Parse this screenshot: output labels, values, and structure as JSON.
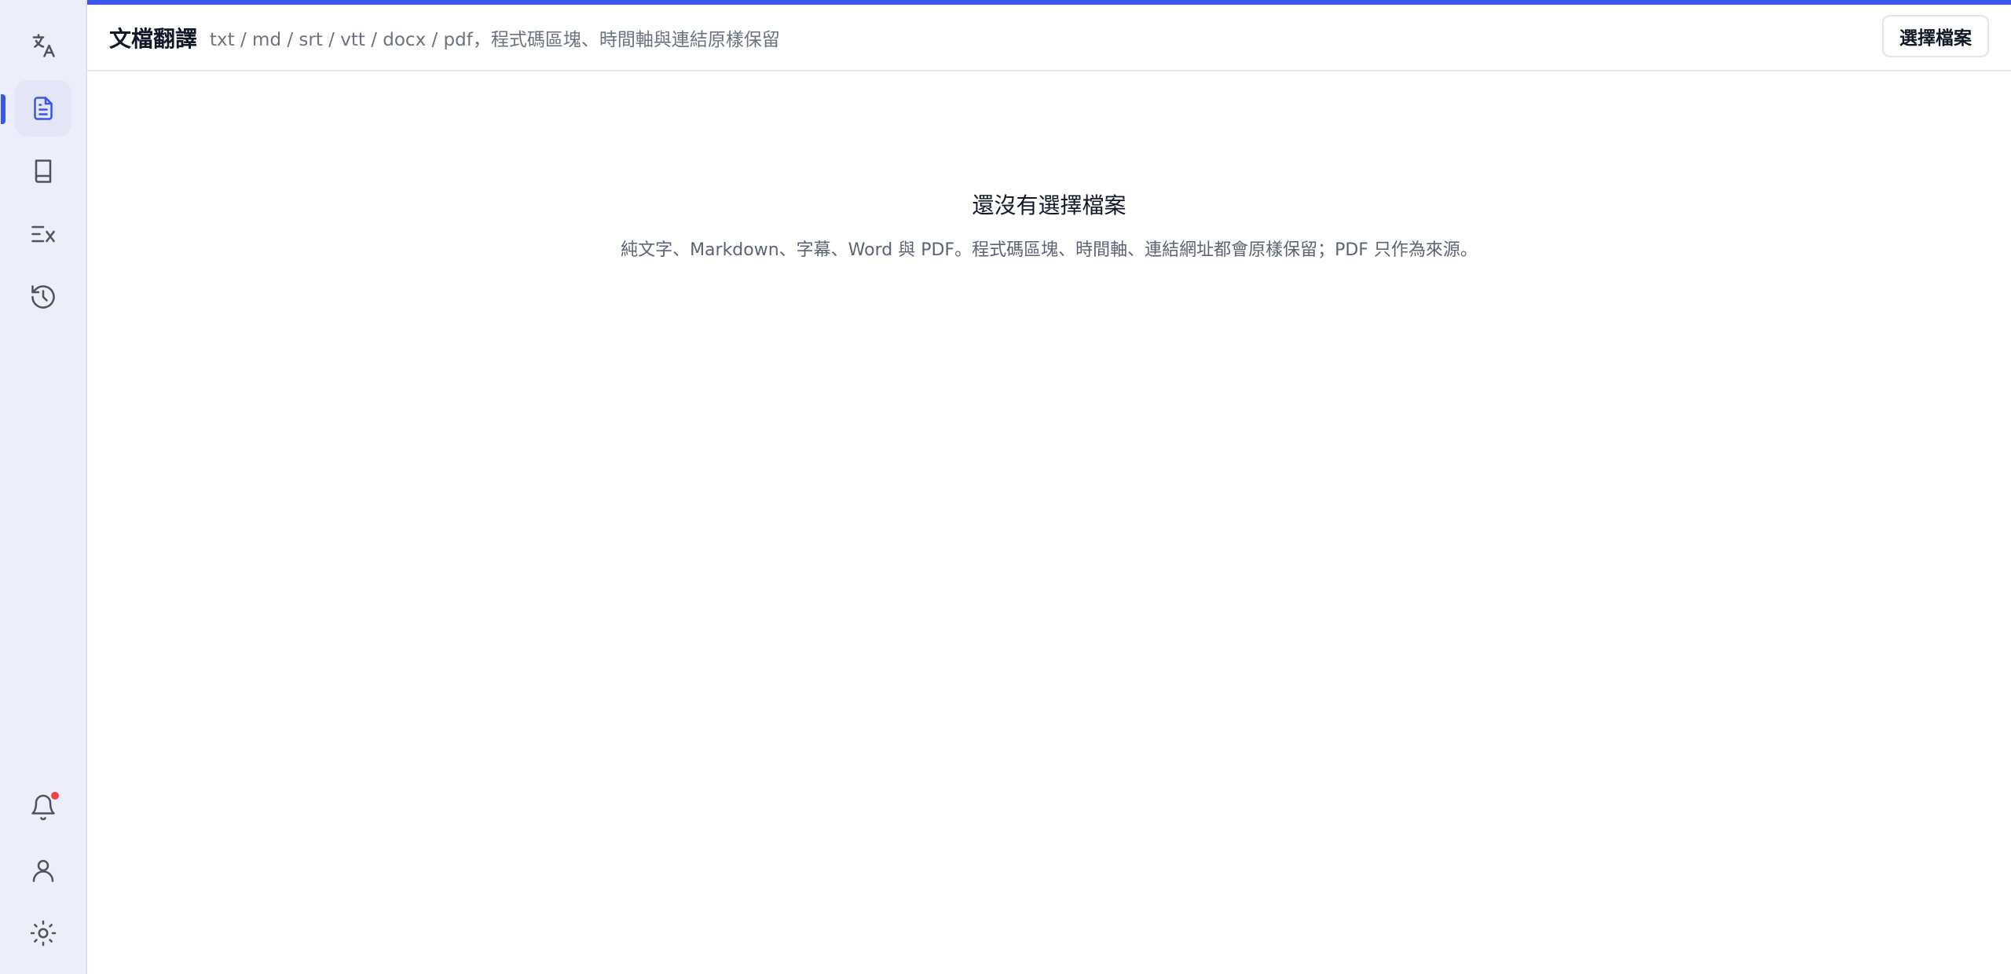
{
  "sidebar": {
    "top_items": [
      {
        "id": "translate",
        "icon": "translate-icon",
        "active": false
      },
      {
        "id": "document",
        "icon": "document-icon",
        "active": true
      },
      {
        "id": "glossary",
        "icon": "book-icon",
        "active": false
      },
      {
        "id": "clear-format",
        "icon": "clear-format-icon",
        "active": false
      },
      {
        "id": "history",
        "icon": "history-icon",
        "active": false
      }
    ],
    "bottom_items": [
      {
        "id": "notifications",
        "icon": "bell-icon",
        "has_badge": true
      },
      {
        "id": "account",
        "icon": "user-icon"
      },
      {
        "id": "theme",
        "icon": "sun-icon"
      }
    ]
  },
  "header": {
    "title": "文檔翻譯",
    "subtitle": "txt / md / srt / vtt / docx / pdf，程式碼區塊、時間軸與連結原樣保留",
    "choose_file_label": "選擇檔案"
  },
  "empty_state": {
    "title": "還沒有選擇檔案",
    "description": "純文字、Markdown、字幕、Word 與 PDF。程式碼區塊、時間軸、連結網址都會原樣保留；PDF 只作為來源。"
  },
  "colors": {
    "accent": "#3b56e8",
    "sidebar_bg": "#eceef9",
    "badge": "#ef4444"
  }
}
